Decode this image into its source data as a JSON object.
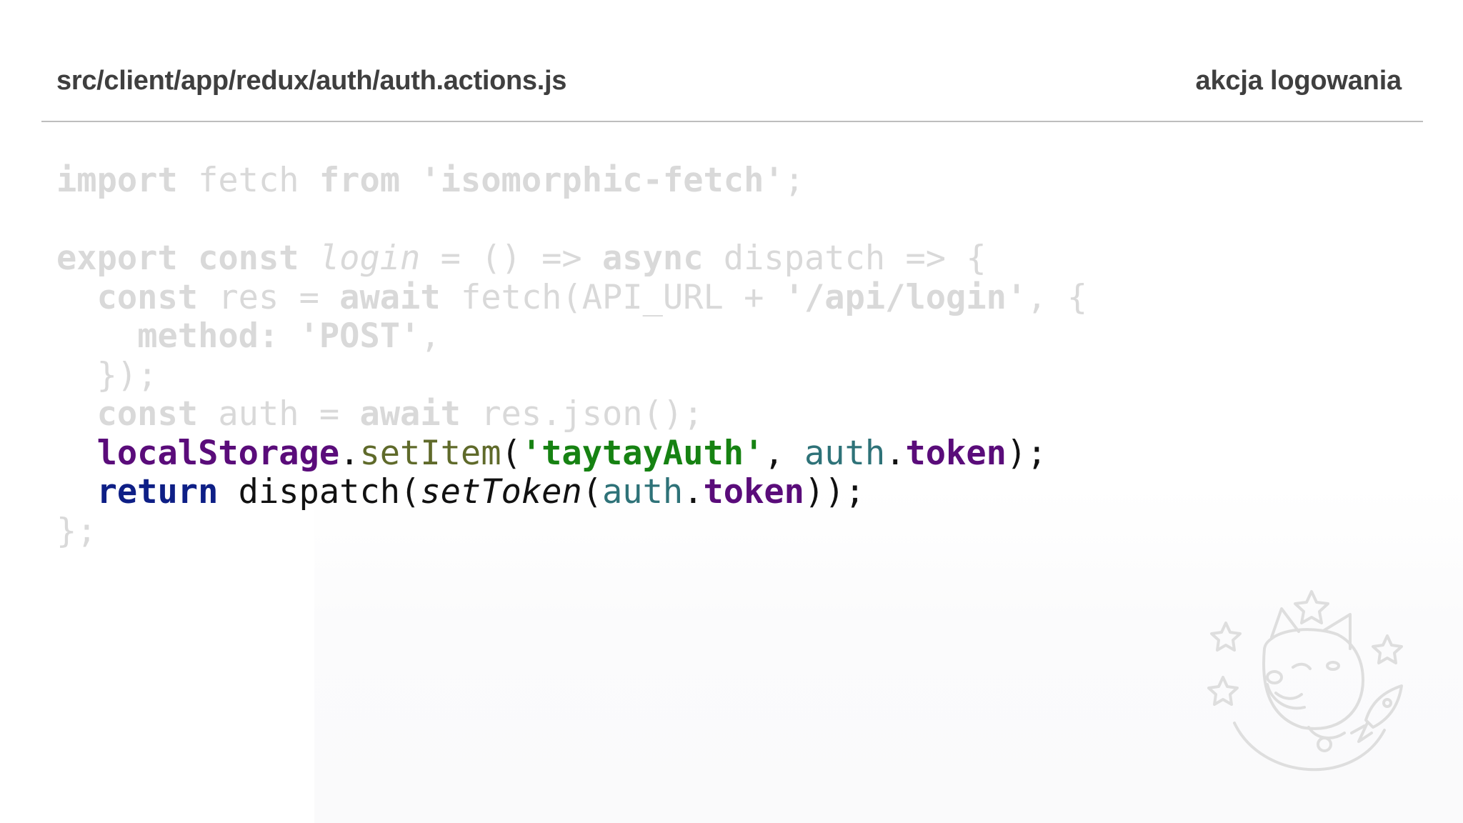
{
  "header": {
    "file_path": "src/client/app/redux/auth/auth.actions.js",
    "title": "akcja logowania"
  },
  "code": {
    "line1": {
      "import": "import",
      "fetch": "fetch",
      "from": "from",
      "module": "'isomorphic-fetch'",
      "semi": ";"
    },
    "line3": {
      "export": "export",
      "const": "const",
      "login": "login",
      "eq": "=",
      "args": "()",
      "arrow1": "=>",
      "async": "async",
      "dispatch": "dispatch",
      "arrow2": "=>",
      "brace": "{"
    },
    "line4": {
      "const": "const",
      "res": "res",
      "eq": "=",
      "await": "await",
      "fetch_call": "fetch(API_URL +",
      "path": "'/api/login'",
      "rest": ", {"
    },
    "line5": {
      "method": "method:",
      "value": "'POST'",
      "comma": ","
    },
    "line6": {
      "close": "});"
    },
    "line7": {
      "const": "const",
      "auth": "auth",
      "eq": "=",
      "await": "await",
      "json_call": "res.json();"
    },
    "line8": {
      "localStorage": "localStorage",
      "dot": ".",
      "setItem": "setItem",
      "open": "(",
      "key": "'taytayAuth'",
      "comma": ", ",
      "auth": "auth",
      "dot2": ".",
      "token": "token",
      "close": ");"
    },
    "line9": {
      "return": "return",
      "dispatch": " dispatch(",
      "setToken": "setToken",
      "open": "(",
      "auth": "auth",
      "dot": ".",
      "token": "token",
      "close": "));"
    },
    "line10": {
      "close": "};"
    }
  },
  "colors": {
    "dimmed_code": "#d9d9d9",
    "identifier_purple": "#5a0c7a",
    "method_olive": "#5f6a2a",
    "string_green": "#168212",
    "variable_teal": "#2e7278",
    "keyword_navy": "#0e1f86",
    "header_text": "#3f3f3f",
    "rule": "#bdbdbd"
  },
  "decor": {
    "mascot_icon": "doge-astronaut-icon"
  }
}
